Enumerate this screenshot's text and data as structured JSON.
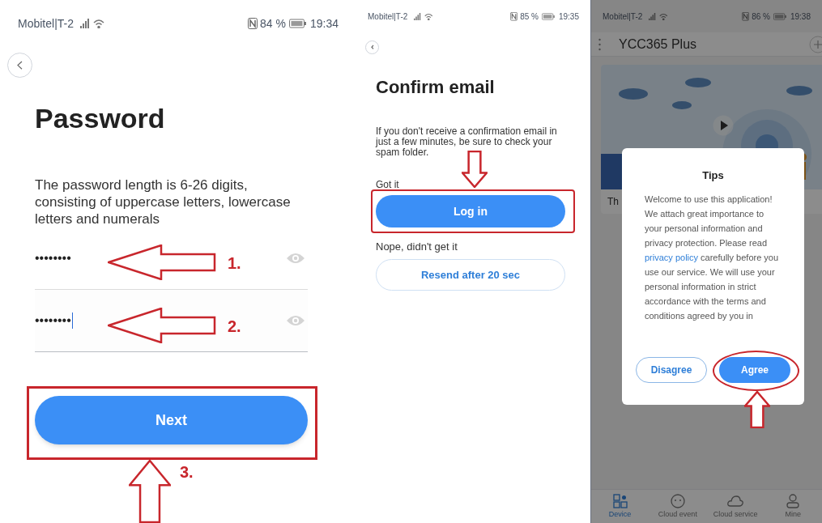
{
  "screens": [
    {
      "kind": "password",
      "status_bar": {
        "carrier": "Mobitel|T-2",
        "battery": "84 %",
        "time": "19:34"
      },
      "title": "Password",
      "description": "The password length is 6-26 digits, consisting of uppercase letters, lowercase letters and numerals",
      "fields": [
        {
          "value": "••••••••",
          "focused": false,
          "marker": "1."
        },
        {
          "value": "••••••••",
          "focused": true,
          "marker": "2."
        }
      ],
      "button": {
        "label": "Next",
        "highlighted": true
      },
      "marker": "3."
    },
    {
      "kind": "confirm_email",
      "status_bar": {
        "carrier": "Mobitel|T-2",
        "battery": "85 %",
        "time": "19:35"
      },
      "title": "Confirm email",
      "description": "If you don't receive a confirmation email in just a few minutes, be sure to check your spam folder.",
      "got_it_label": "Got it",
      "login_button": {
        "label": "Log in",
        "highlighted": true
      },
      "nope_label": "Nope, didn't get it",
      "resend_button": {
        "label": "Resend after 20 sec"
      }
    },
    {
      "kind": "home_dialog",
      "status_bar": {
        "carrier": "Mobitel|T-2",
        "battery": "86 %",
        "time": "19:38"
      },
      "app_title": "YCC365 Plus",
      "card_caption": "Th",
      "dialog": {
        "title": "Tips",
        "text_before": "Welcome to use this application! We attach great importance to your personal information and privacy protection. Please read ",
        "link": "privacy policy",
        "text_after": " carefully before you use our service. We will use your personal information in strict accordance with the terms and conditions agreed by you in",
        "buttons": [
          {
            "label": "Disagree",
            "kind": "outline",
            "highlighted": false
          },
          {
            "label": "Agree",
            "kind": "filled",
            "highlighted": true
          }
        ]
      },
      "nav": [
        {
          "label": "Device",
          "selected": true
        },
        {
          "label": "Cloud event",
          "selected": false
        },
        {
          "label": "Cloud service",
          "selected": false
        },
        {
          "label": "Mine",
          "selected": false
        }
      ]
    }
  ]
}
